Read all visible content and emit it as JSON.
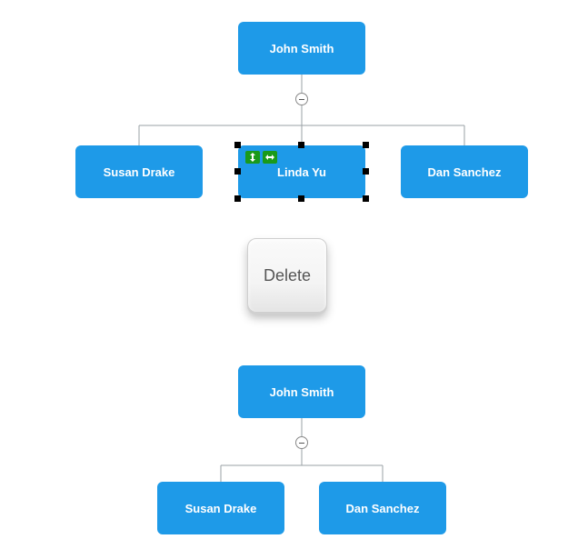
{
  "chart_data": [
    {
      "type": "org-chart",
      "state": "before",
      "selected_node": "Linda Yu",
      "root": {
        "name": "John Smith",
        "children": [
          {
            "name": "Susan Drake"
          },
          {
            "name": "Linda Yu"
          },
          {
            "name": "Dan Sanchez"
          }
        ]
      }
    },
    {
      "type": "org-chart",
      "state": "after",
      "root": {
        "name": "John Smith",
        "children": [
          {
            "name": "Susan Drake"
          },
          {
            "name": "Dan Sanchez"
          }
        ]
      }
    }
  ],
  "key_label": "Delete",
  "nodes_top": {
    "root": "John Smith",
    "child0": "Susan Drake",
    "child1": "Linda Yu",
    "child2": "Dan Sanchez"
  },
  "nodes_bottom": {
    "root": "John Smith",
    "child0": "Susan Drake",
    "child1": "Dan Sanchez"
  }
}
